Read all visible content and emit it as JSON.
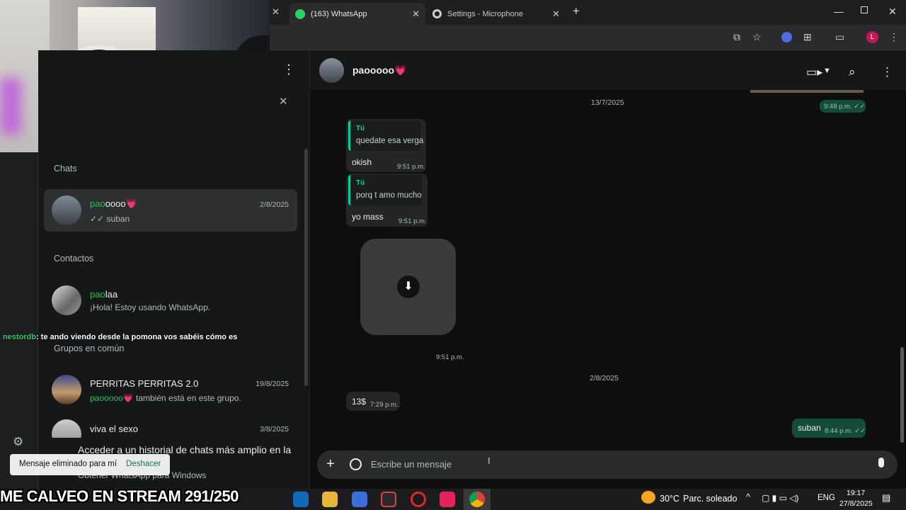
{
  "browser": {
    "tabs": [
      {
        "label": "(163) WhatsApp",
        "icon": "whatsapp-icon",
        "active": true
      },
      {
        "label": "Settings - Microphone",
        "icon": "gear-icon",
        "active": false
      }
    ],
    "new_tab": "+",
    "profile_initial": "L"
  },
  "sidebar": {
    "chats_heading": "Chats",
    "chats": [
      {
        "name_hl": "pao",
        "name_rest": "oooo💗",
        "date": "2/8/2025",
        "preview": "✓✓ suban"
      }
    ],
    "contacts_heading": "Contactos",
    "contacts": [
      {
        "name_hl": "pao",
        "name_rest": "laa",
        "preview": "¡Hola! Estoy usando WhatsApp."
      }
    ],
    "groups_heading": "Grupos en común",
    "groups": [
      {
        "name": "PERRITAS PERRITAS 2.0",
        "date": "19/8/2025",
        "preview_hl": "paooooo💗",
        "preview_rest": " también está en este grupo."
      },
      {
        "name": "viva el sexo",
        "date": "3/8/2025"
      }
    ],
    "promo_title": "Acceder a un historial de chats más amplio en la",
    "promo_sub": "Obtener WhatsApp para Windows"
  },
  "chat": {
    "contact_name": "paooooo💗",
    "messages": {
      "date1": "13/7/2025",
      "top_time": "9:48 p.m. ✓✓",
      "reply1_who": "Tú",
      "reply1_quote": "quedate esa verga",
      "reply1_text": "okish",
      "reply1_time": "9:51 p.m.",
      "reply2_who": "Tú",
      "reply2_quote": "porq t amo mucho",
      "reply2_text": "yo mass",
      "reply2_time": "9:51 p.m.",
      "media_time": "9:51 p.m.",
      "date2": "2/8/2025",
      "in_text": "13$",
      "in_time": "7:29 p.m.",
      "out_text": "suban",
      "out_time": "8:44 p.m. ✓✓"
    },
    "composer_placeholder": "Escribe un mensaje"
  },
  "stream_chat": {
    "user": "nestordb",
    "message": ": te ando viendo desde la pomona vos sabéis cómo es"
  },
  "toast": {
    "text": "Mensaje eliminado para mí",
    "action": "Deshacer"
  },
  "overlay_text": "ME CALVEO EN STREAM 291/250",
  "taskbar": {
    "weather_temp": "30°C",
    "weather_desc": "Parc. soleado",
    "lang": "ENG",
    "time": "19:17",
    "date": "27/8/2025"
  }
}
